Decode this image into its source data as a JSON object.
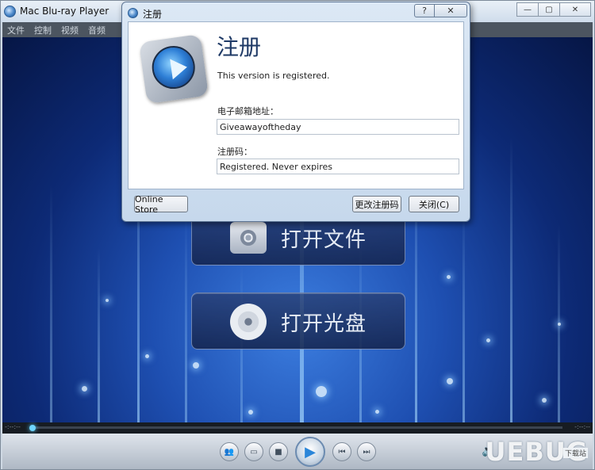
{
  "main_window": {
    "title": "Mac Blu-ray Player",
    "menu": [
      "文件",
      "控制",
      "视频",
      "音频"
    ],
    "buttons": {
      "minimize": "—",
      "maximize": "▢",
      "close": "✕"
    }
  },
  "video_area": {
    "open_file_label": "打开文件",
    "open_disc_label": "打开光盘"
  },
  "controls": {
    "icons": [
      "users-icon",
      "folder-icon",
      "stop-icon",
      "play-icon",
      "previous-icon",
      "next-icon",
      "volume-icon"
    ]
  },
  "watermark": {
    "text": "UEBUG",
    "sub": "下载站"
  },
  "dialog": {
    "title": "注册",
    "help_label": "?",
    "close_label": "✕",
    "heading": "注册",
    "status": "This version is registered.",
    "email_label": "电子邮箱地址：",
    "email_value": "Giveawayoftheday",
    "code_label": "注册码：",
    "code_value": "Registered. Never expires",
    "online_store_label": "Online Store",
    "change_code_label": "更改注册码",
    "close_button_label": "关闭(C)"
  }
}
